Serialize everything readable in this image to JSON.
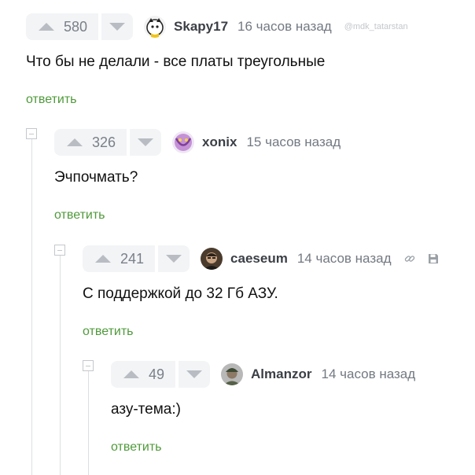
{
  "comments": [
    {
      "rating": "580",
      "username": "Skapy17",
      "time": "16 часов назад",
      "watermark": "@mdk_tatarstan",
      "text": "Что бы не делали - все платы треугольные",
      "reply_label": "ответить",
      "avatar_icon": "avatar-cat-icon"
    },
    {
      "rating": "326",
      "username": "xonix",
      "time": "15 часов назад",
      "text": "Эчпочмать?",
      "reply_label": "ответить",
      "avatar_icon": "avatar-purple-icon"
    },
    {
      "rating": "241",
      "username": "caeseum",
      "time": "14 часов назад",
      "text": "С поддержкой до 32 Гб АЗУ.",
      "reply_label": "ответить",
      "avatar_icon": "avatar-man-icon"
    },
    {
      "rating": "49",
      "username": "Almanzor",
      "time": "14 часов назад",
      "text": "азу-тема:)",
      "reply_label": "ответить",
      "avatar_icon": "avatar-soldier-icon"
    }
  ],
  "colors": {
    "reply_link": "#4f9a3a",
    "vote_bg": "#f3f4f6",
    "muted_text": "#737982"
  }
}
